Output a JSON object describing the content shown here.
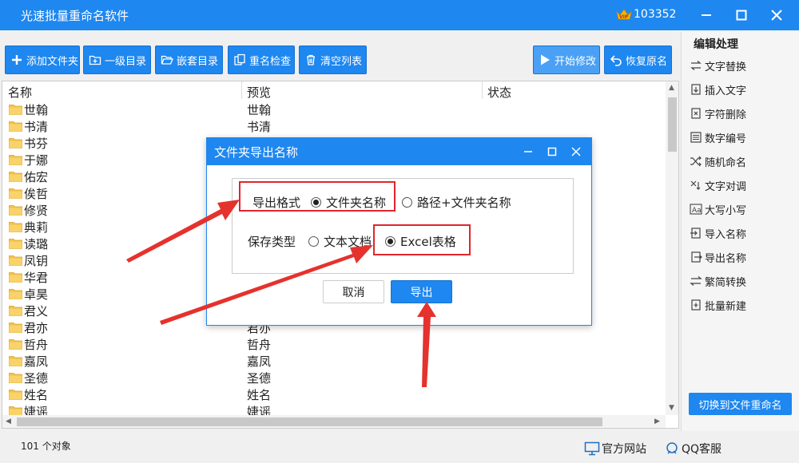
{
  "app": {
    "title": "光速批量重命名软件",
    "vip_number": "103352",
    "brand_color": "#1e87f0"
  },
  "toolbar": {
    "buttons": [
      {
        "label": "添加文件夹",
        "icon": "plus-icon"
      },
      {
        "label": "一级目录",
        "icon": "folder-plus-icon"
      },
      {
        "label": "嵌套目录",
        "icon": "folder-open-icon"
      },
      {
        "label": "重名检查",
        "icon": "copy-icon"
      },
      {
        "label": "清空列表",
        "icon": "trash-icon"
      },
      {
        "label": "开始修改",
        "icon": "play-icon"
      },
      {
        "label": "恢复原名",
        "icon": "undo-icon"
      }
    ]
  },
  "panel": {
    "title": "编辑处理",
    "items": [
      "文字替换",
      "插入文字",
      "字符删除",
      "数字编号",
      "随机命名",
      "文字对调",
      "大写小写",
      "导入名称",
      "导出名称",
      "繁简转换",
      "批量新建"
    ],
    "switch_label": "切换到文件重命名"
  },
  "list": {
    "columns": [
      "名称",
      "预览",
      "状态"
    ],
    "rows": [
      {
        "name": "世翰",
        "preview": "世翰"
      },
      {
        "name": "书清",
        "preview": "书清"
      },
      {
        "name": "书芬",
        "preview": ""
      },
      {
        "name": "于娜",
        "preview": ""
      },
      {
        "name": "佑宏",
        "preview": ""
      },
      {
        "name": "俟哲",
        "preview": ""
      },
      {
        "name": "修贤",
        "preview": ""
      },
      {
        "name": "典莉",
        "preview": ""
      },
      {
        "name": "读璐",
        "preview": ""
      },
      {
        "name": "凤钥",
        "preview": ""
      },
      {
        "name": "华君",
        "preview": ""
      },
      {
        "name": "卓昊",
        "preview": ""
      },
      {
        "name": "君义",
        "preview": ""
      },
      {
        "name": "君亦",
        "preview": "君亦"
      },
      {
        "name": "哲舟",
        "preview": "哲舟"
      },
      {
        "name": "嘉凤",
        "preview": "嘉凤"
      },
      {
        "name": "圣德",
        "preview": "圣德"
      },
      {
        "name": "姓名",
        "preview": "姓名"
      },
      {
        "name": "婕谣",
        "preview": "婕谣"
      }
    ]
  },
  "status": {
    "count": "101 个对象",
    "website": "官方网站",
    "qq": "QQ客服"
  },
  "dialog": {
    "title": "文件夹导出名称",
    "format_label": "导出格式",
    "format_options": [
      "文件夹名称",
      "路径+文件夹名称"
    ],
    "format_selected": "文件夹名称",
    "type_label": "保存类型",
    "type_options": [
      "文本文档",
      "Excel表格"
    ],
    "type_selected": "Excel表格",
    "cancel": "取消",
    "export": "导出"
  },
  "annotation_color": "#e0262c"
}
